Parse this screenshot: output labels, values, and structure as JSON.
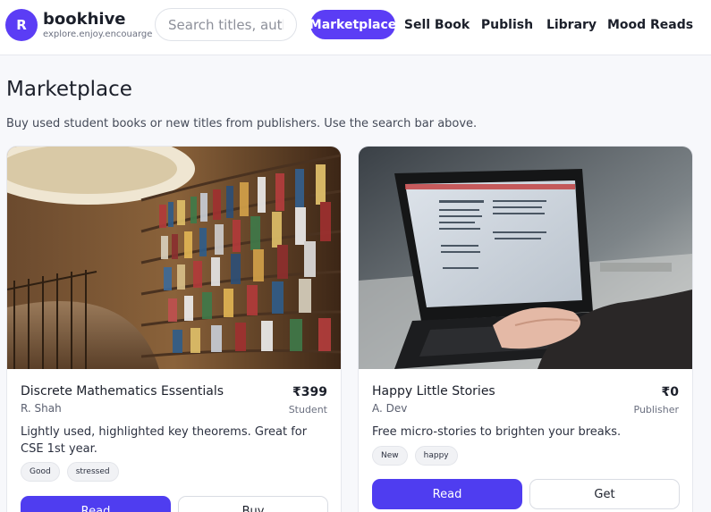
{
  "brand": {
    "avatar_letter": "R",
    "name": "bookhive",
    "tagline": "explore.enjoy.encouarge"
  },
  "search": {
    "placeholder": "Search titles, authors",
    "value": ""
  },
  "nav": [
    {
      "label": "Marketplace",
      "active": true
    },
    {
      "label": "Sell Book",
      "active": false
    },
    {
      "label": "Publish",
      "active": false
    },
    {
      "label": "Library",
      "active": false
    },
    {
      "label": "Mood Reads",
      "active": false
    }
  ],
  "page": {
    "title": "Marketplace",
    "description": "Buy used student books or new titles from publishers. Use the search bar above."
  },
  "books": [
    {
      "title": "Discrete Mathematics Essentials",
      "author": "R. Shah",
      "price": "₹399",
      "seller_type": "Student",
      "description": "Lightly used, highlighted key theorems. Great for CSE 1st year.",
      "tags": [
        "Good",
        "stressed"
      ],
      "read_label": "Read",
      "action_label": "Buy"
    },
    {
      "title": "Happy Little Stories",
      "author": "A. Dev",
      "price": "₹0",
      "seller_type": "Publisher",
      "description": "Free micro-stories to brighten your breaks.",
      "tags": [
        "New",
        "happy"
      ],
      "read_label": "Read",
      "action_label": "Get"
    }
  ],
  "colors": {
    "accent": "#5b3df5",
    "button_primary": "#4f3df0"
  }
}
